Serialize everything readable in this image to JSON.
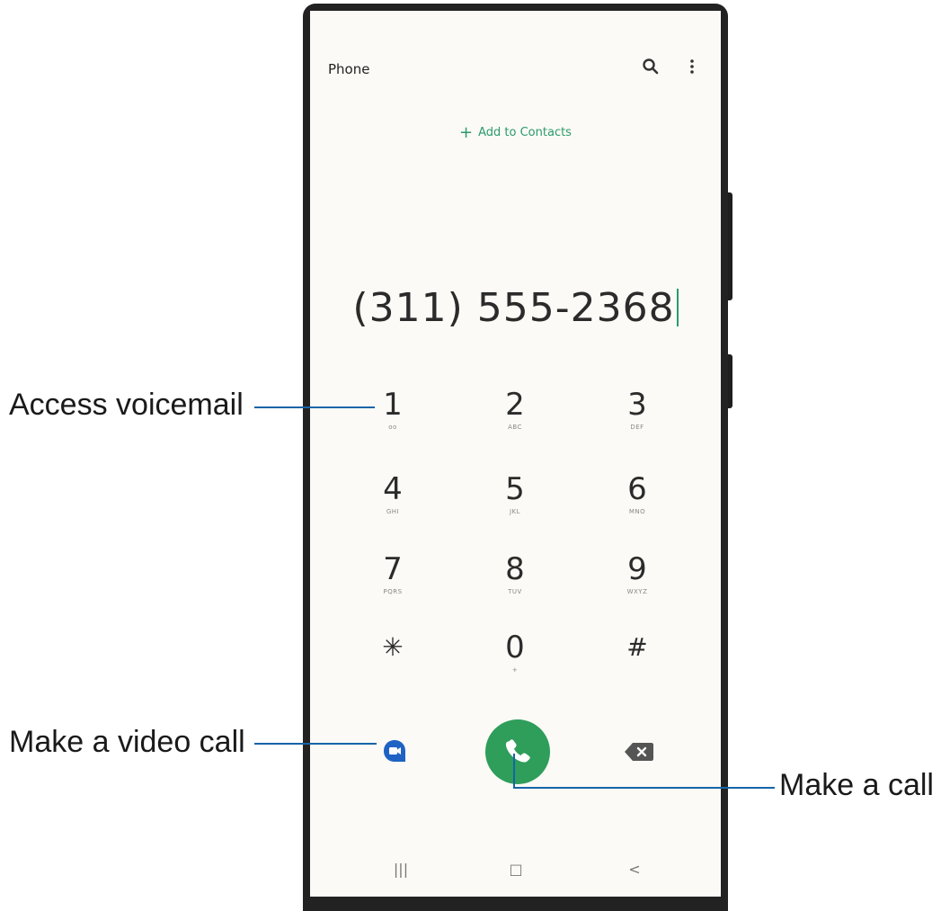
{
  "app": {
    "title": "Phone"
  },
  "toolbar": {
    "search_icon": "search-icon",
    "more_icon": "more-vertical-icon"
  },
  "add_contacts": {
    "label": "Add to Contacts"
  },
  "dialer": {
    "number": "(311) 555-2368",
    "keys": [
      {
        "digit": "1",
        "letters": "oo"
      },
      {
        "digit": "2",
        "letters": "ABC"
      },
      {
        "digit": "3",
        "letters": "DEF"
      },
      {
        "digit": "4",
        "letters": "GHI"
      },
      {
        "digit": "5",
        "letters": "JKL"
      },
      {
        "digit": "6",
        "letters": "MNO"
      },
      {
        "digit": "7",
        "letters": "PQRS"
      },
      {
        "digit": "8",
        "letters": "TUV"
      },
      {
        "digit": "9",
        "letters": "WXYZ"
      },
      {
        "digit": "✳",
        "letters": ""
      },
      {
        "digit": "0",
        "letters": "+"
      },
      {
        "digit": "#",
        "letters": ""
      }
    ]
  },
  "actions": {
    "video_icon": "video-call-icon",
    "call_icon": "phone-icon",
    "backspace_icon": "backspace-icon"
  },
  "nav": {
    "recents": "|||",
    "home": "□",
    "back": "<"
  },
  "callouts": {
    "voicemail": "Access voicemail",
    "video_call": "Make a video call",
    "call": "Make a call"
  },
  "colors": {
    "accent": "#2a9b6a",
    "call_button": "#2e9e5a",
    "video": "#1e63c4",
    "callout_line": "#1565a8"
  }
}
